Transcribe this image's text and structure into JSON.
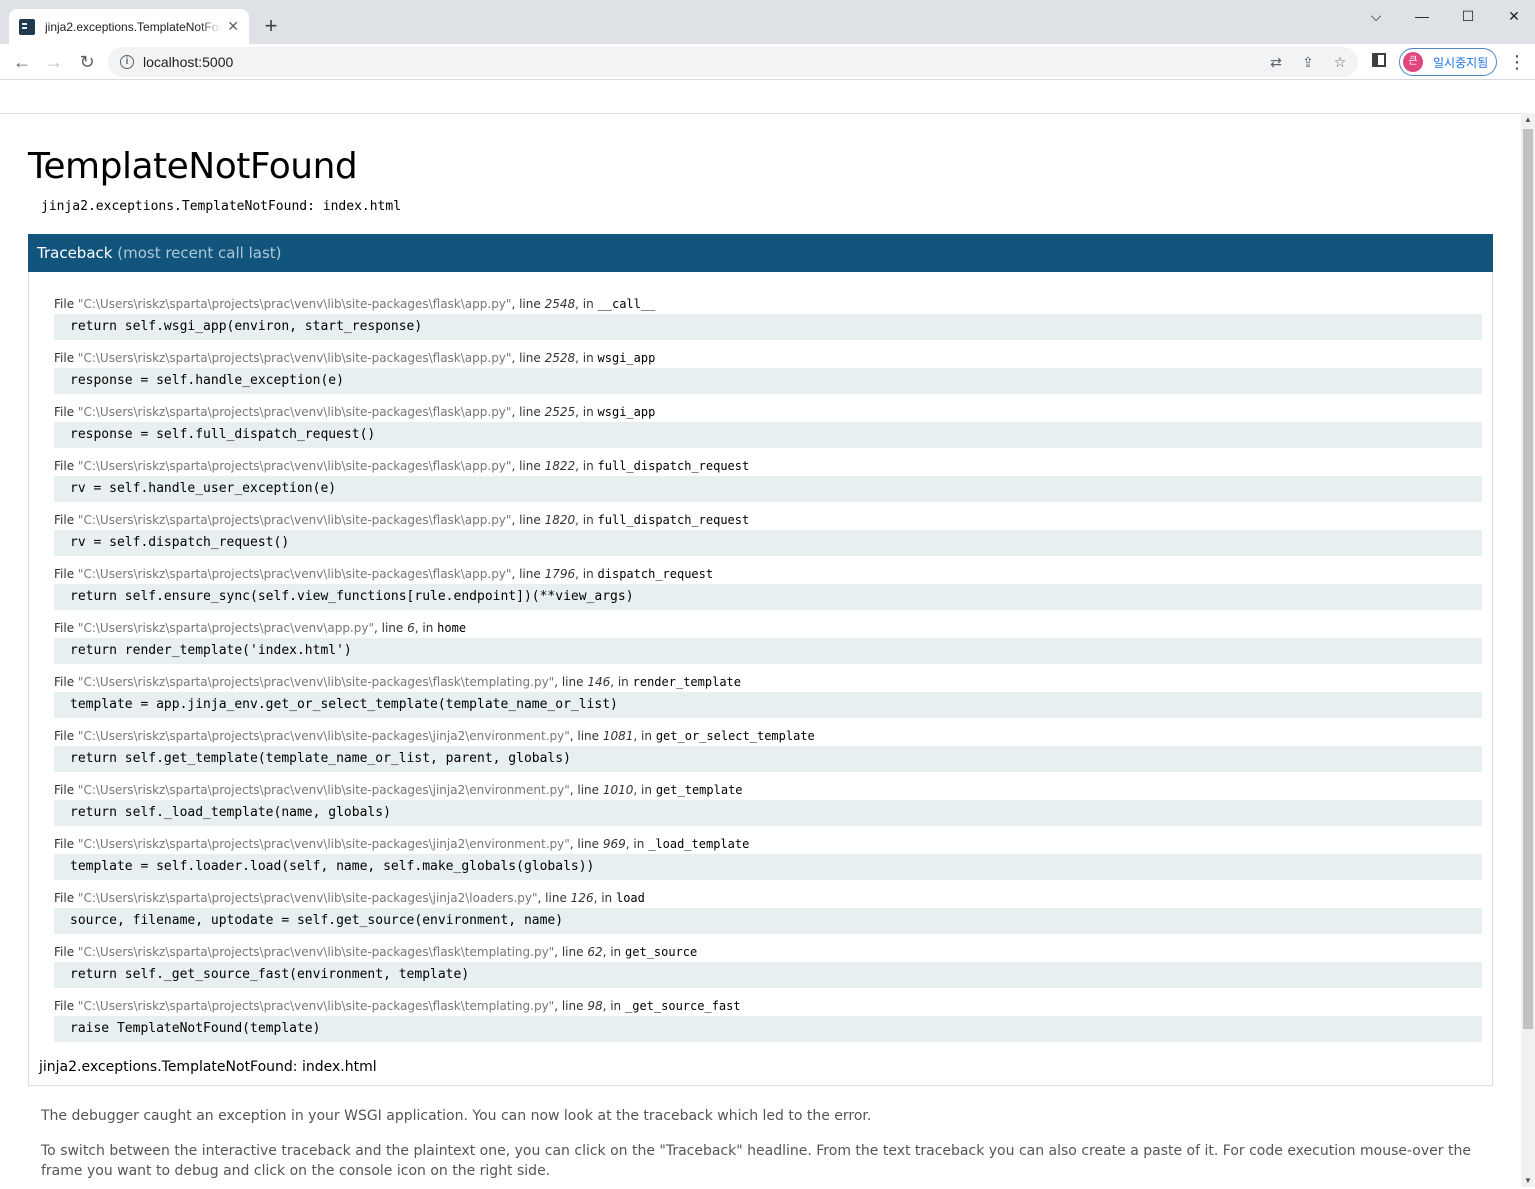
{
  "browser": {
    "tab_title": "jinja2.exceptions.TemplateNotFound: index.html",
    "url": "localhost:5000",
    "profile_label": "일시중지됨",
    "profile_initial": "큰"
  },
  "page": {
    "title": "TemplateNotFound",
    "error_message": "jinja2.exceptions.TemplateNotFound: index.html",
    "traceback_label": "Traceback",
    "traceback_sub": "(most recent call last)",
    "frames": [
      {
        "file": "\"C:\\Users\\riskz\\sparta\\projects\\prac\\venv\\lib\\site-packages\\flask\\app.py\"",
        "line": "2548",
        "func": "__call__",
        "code": "return self.wsgi_app(environ, start_response)"
      },
      {
        "file": "\"C:\\Users\\riskz\\sparta\\projects\\prac\\venv\\lib\\site-packages\\flask\\app.py\"",
        "line": "2528",
        "func": "wsgi_app",
        "code": "response = self.handle_exception(e)"
      },
      {
        "file": "\"C:\\Users\\riskz\\sparta\\projects\\prac\\venv\\lib\\site-packages\\flask\\app.py\"",
        "line": "2525",
        "func": "wsgi_app",
        "code": "response = self.full_dispatch_request()"
      },
      {
        "file": "\"C:\\Users\\riskz\\sparta\\projects\\prac\\venv\\lib\\site-packages\\flask\\app.py\"",
        "line": "1822",
        "func": "full_dispatch_request",
        "code": "rv = self.handle_user_exception(e)"
      },
      {
        "file": "\"C:\\Users\\riskz\\sparta\\projects\\prac\\venv\\lib\\site-packages\\flask\\app.py\"",
        "line": "1820",
        "func": "full_dispatch_request",
        "code": "rv = self.dispatch_request()"
      },
      {
        "file": "\"C:\\Users\\riskz\\sparta\\projects\\prac\\venv\\lib\\site-packages\\flask\\app.py\"",
        "line": "1796",
        "func": "dispatch_request",
        "code": "return self.ensure_sync(self.view_functions[rule.endpoint])(**view_args)"
      },
      {
        "file": "\"C:\\Users\\riskz\\sparta\\projects\\prac\\venv\\app.py\"",
        "line": "6",
        "func": "home",
        "code": "return render_template('index.html')"
      },
      {
        "file": "\"C:\\Users\\riskz\\sparta\\projects\\prac\\venv\\lib\\site-packages\\flask\\templating.py\"",
        "line": "146",
        "func": "render_template",
        "code": "template = app.jinja_env.get_or_select_template(template_name_or_list)"
      },
      {
        "file": "\"C:\\Users\\riskz\\sparta\\projects\\prac\\venv\\lib\\site-packages\\jinja2\\environment.py\"",
        "line": "1081",
        "func": "get_or_select_template",
        "code": "return self.get_template(template_name_or_list, parent, globals)"
      },
      {
        "file": "\"C:\\Users\\riskz\\sparta\\projects\\prac\\venv\\lib\\site-packages\\jinja2\\environment.py\"",
        "line": "1010",
        "func": "get_template",
        "code": "return self._load_template(name, globals)"
      },
      {
        "file": "\"C:\\Users\\riskz\\sparta\\projects\\prac\\venv\\lib\\site-packages\\jinja2\\environment.py\"",
        "line": "969",
        "func": "_load_template",
        "code": "template = self.loader.load(self, name, self.make_globals(globals))"
      },
      {
        "file": "\"C:\\Users\\riskz\\sparta\\projects\\prac\\venv\\lib\\site-packages\\jinja2\\loaders.py\"",
        "line": "126",
        "func": "load",
        "code": "source, filename, uptodate = self.get_source(environment, name)"
      },
      {
        "file": "\"C:\\Users\\riskz\\sparta\\projects\\prac\\venv\\lib\\site-packages\\flask\\templating.py\"",
        "line": "62",
        "func": "get_source",
        "code": "return self._get_source_fast(environment, template)"
      },
      {
        "file": "\"C:\\Users\\riskz\\sparta\\projects\\prac\\venv\\lib\\site-packages\\flask\\templating.py\"",
        "line": "98",
        "func": "_get_source_fast",
        "code": "raise TemplateNotFound(template)"
      }
    ],
    "frame_labels": {
      "file": "File",
      "line": ", line",
      "in": ", in"
    },
    "final_error": "jinja2.exceptions.TemplateNotFound: index.html",
    "explanation_1": "The debugger caught an exception in your WSGI application. You can now look at the traceback which led to the error.",
    "explanation_2": "To switch between the interactive traceback and the plaintext one, you can click on the \"Traceback\" headline. From the text traceback you can also create a paste of it. For code execution mouse-over the frame you want to debug and click on the console icon on the right side."
  },
  "icons": [
    "terminal-favicon",
    "close-icon",
    "plus-icon",
    "chevron-down-icon",
    "minimize-icon",
    "maximize-icon",
    "window-close-icon",
    "back-icon",
    "forward-icon",
    "reload-icon",
    "info-icon",
    "translate-icon",
    "share-icon",
    "star-icon",
    "side-panel-icon",
    "more-icon"
  ],
  "colors": {
    "traceback_header": "#11557c",
    "code_bg": "#e8eff0",
    "tabbar": "#dee1e6"
  }
}
